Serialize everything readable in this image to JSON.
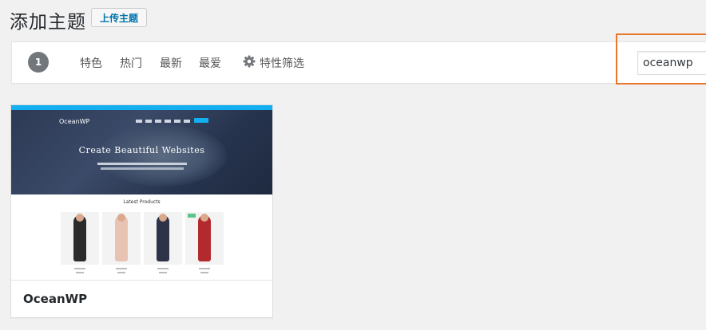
{
  "header": {
    "title": "添加主题",
    "upload_label": "上传主题"
  },
  "filters": {
    "count": "1",
    "links": [
      "特色",
      "热门",
      "最新",
      "最爱"
    ],
    "feature_filter_label": "特性筛选",
    "feature_filter_icon": "gear-icon"
  },
  "search": {
    "value": "oceanwp",
    "highlight_color": "#e8772e"
  },
  "themes": [
    {
      "name": "OceanWP",
      "screenshot": {
        "logo": "OceanWP",
        "headline": "Create Beautiful Websites",
        "section_title": "Latest Products"
      }
    }
  ],
  "colors": {
    "accent": "#0073aa",
    "badge_bg": "#72777c",
    "oceanwp_blue": "#13aff0"
  }
}
